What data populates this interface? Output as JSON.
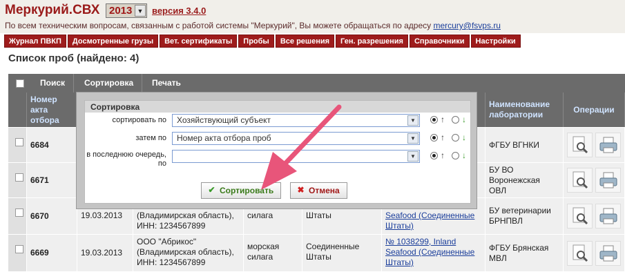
{
  "header": {
    "brand": "Меркурий.",
    "brand_suffix": "СВХ",
    "year": "2013",
    "version": "версия 3.4.0",
    "support_text": "По всем техническим вопросам, связанным с работой системы \"Меркурий\", Вы можете обращаться по адресу ",
    "support_email": "mercury@fsvps.ru"
  },
  "nav": [
    "Журнал ПВКП",
    "Досмотренные грузы",
    "Вет. сертификаты",
    "Пробы",
    "Все решения",
    "Ген. разрешения",
    "Справочники",
    "Настройки"
  ],
  "list_title": "Список проб (найдено: 4)",
  "toolbar": {
    "search": "Поиск",
    "sort": "Сортировка",
    "print": "Печать"
  },
  "table": {
    "headers": {
      "act_number": "Номер акта отбора проб",
      "lab_name": "Наименование лаборатории",
      "operations": "Операции"
    },
    "rows": [
      {
        "num": "6684",
        "date": "",
        "subject": "",
        "product": "",
        "country": "",
        "cert": "",
        "lab": "ФГБУ ВГНКИ"
      },
      {
        "num": "6671",
        "date": "",
        "subject": "",
        "product": "",
        "country": "",
        "cert": "",
        "lab": "БУ ВО Воронежская ОВЛ"
      },
      {
        "num": "6670",
        "date": "19.03.2013",
        "subject": "(Владимирская область), ИНН: 1234567899",
        "product": "силага",
        "country": "Штаты",
        "cert": "Seafood (Соединенные Штаты)",
        "lab": "БУ ветеринарии БРНПВЛ"
      },
      {
        "num": "6669",
        "date": "19.03.2013",
        "subject": "ООО \"Абрикос\" (Владимирская область), ИНН: 1234567899",
        "product": "морская силага",
        "country": "Соединенные Штаты",
        "cert": "№ 1038299, Inland Seafood (Соединенные Штаты)",
        "lab": "ФГБУ Брянская МВЛ"
      }
    ]
  },
  "sort_dialog": {
    "title": "Сортировка",
    "sort_by_label": "сортировать по",
    "sort_by_value": "Хозяйствующий субъект",
    "then_by_label": "затем по",
    "then_by_value": "Номер акта отбора проб",
    "last_label": "в последнюю очередь, по",
    "last_value": "",
    "ok_label": "Сортировать",
    "cancel_label": "Отмена",
    "up_glyph": "↑",
    "down_glyph": "↓"
  },
  "colors": {
    "brand_red": "#9e1c1c",
    "link_blue": "#1a3d9a",
    "arrow_pink": "#e8557a"
  }
}
